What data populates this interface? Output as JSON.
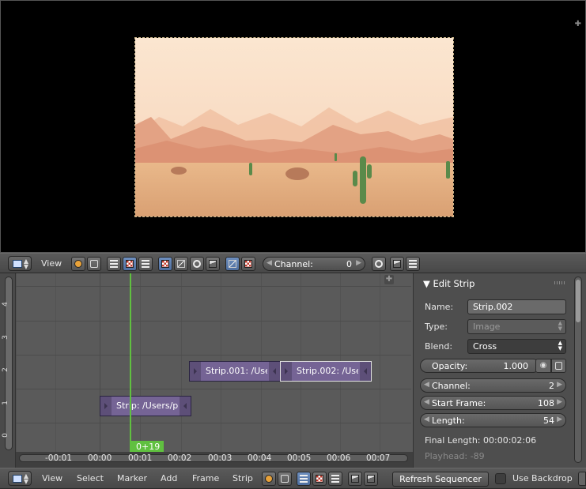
{
  "preview": {
    "scene": "desert-landscape-render"
  },
  "preview_header": {
    "view_menu": "View",
    "channel_label": "Channel:",
    "channel_value": "0"
  },
  "timeline": {
    "channel_labels": [
      "0",
      "1",
      "2",
      "3",
      "4"
    ],
    "time_ticks": [
      "-00:01",
      "00:00",
      "00:01",
      "00:02",
      "00:03",
      "00:04",
      "00:05",
      "00:06",
      "00:07"
    ],
    "playhead_label": "0+19",
    "strips": [
      {
        "name": "Strip: /Users/pa",
        "channel": 1,
        "color": "#756495"
      },
      {
        "name": "Strip.001: /Use",
        "channel": 2,
        "color": "#756495"
      },
      {
        "name": "Strip.002: /Use",
        "channel": 2,
        "color": "#756495",
        "selected": true
      }
    ]
  },
  "properties": {
    "panel_title": "Edit Strip",
    "name_label": "Name:",
    "name_value": "Strip.002",
    "type_label": "Type:",
    "type_value": "Image",
    "blend_label": "Blend:",
    "blend_value": "Cross",
    "opacity_label": "Opacity:",
    "opacity_value": "1.000",
    "channel_label": "Channel:",
    "channel_value": "2",
    "start_frame_label": "Start Frame:",
    "start_frame_value": "108",
    "length_label": "Length:",
    "length_value": "54",
    "final_length": "Final Length: 00:00:02:06",
    "playhead": "Playhead: -89"
  },
  "sequencer_header": {
    "menus": [
      "View",
      "Select",
      "Marker",
      "Add",
      "Frame",
      "Strip"
    ],
    "refresh_label": "Refresh Sequencer",
    "use_backdrop_label": "Use Backdrop"
  },
  "colors": {
    "playhead": "#60c040",
    "strip": "#756495",
    "accent_active": "#5a7fb5"
  }
}
